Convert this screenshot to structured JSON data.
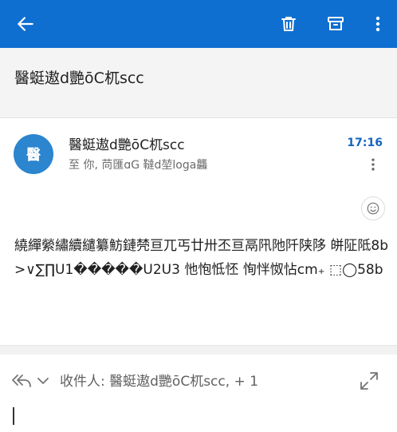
{
  "colors": {
    "topbar": "#0f6fd0",
    "accent": "#1565c0",
    "avatar": "#2b85cf"
  },
  "toolbar": {
    "back_icon": "arrow-left-icon",
    "delete_icon": "trash-icon",
    "archive_icon": "archive-icon",
    "more_icon": "more-vertical-icon"
  },
  "subject": "醫蜓遨d艷ōC杌scc",
  "message": {
    "avatar_text": "醫",
    "sender": "醫蜓遨d艷ōC杌scc",
    "recipients": "至 你, 苘匯ɑG 韃d堃loga龘",
    "time": "17:16",
    "body": "繞繟縈繡續繾纂魴鏈棾亘兀丐廿卅丕亘鬲阠阤阡陕陊 皏阷阺8b>∨∑∏U1�����U2U3 忚怉怟怌 恂怑怓怗cm₊ ⬚◯58b"
  },
  "reply": {
    "to_text": "收件人: 醫蜓遨d艷ōC杌scc, + 1"
  }
}
